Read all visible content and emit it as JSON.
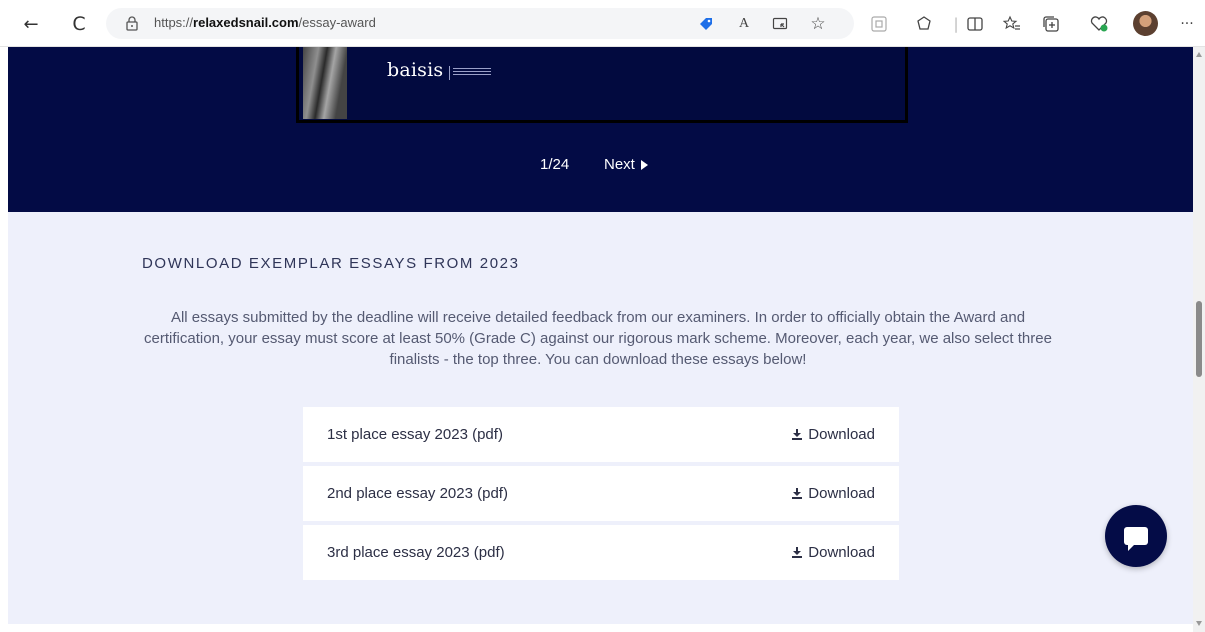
{
  "browser": {
    "url_prefix": "https://",
    "url_domain": "relaxedsnail.com",
    "url_path": "/essay-award",
    "nav": {
      "back": "←",
      "reload": "C"
    },
    "address_icons": [
      "price-tag-icon",
      "read-aloud-icon",
      "app-icon",
      "favorite-star-icon"
    ],
    "toolbar_icons": [
      "extension-icon",
      "refresh-extension-icon",
      "split-screen-icon",
      "favorites-icon",
      "collections-icon",
      "health-icon",
      "profile-avatar",
      "more-icon"
    ],
    "more_label": "···",
    "read_aloud_label": "A",
    "favorite_label": "☆"
  },
  "banner": {
    "brand": "baisis",
    "pager_count": "1/24",
    "next_label": "Next"
  },
  "section": {
    "heading": "DOWNLOAD EXEMPLAR ESSAYS FROM 2023",
    "paragraph": "All essays submitted by the deadline will receive detailed feedback from our examiners. In order to officially obtain the Award and certification, your essay must score at least 50% (Grade C) against our rigorous mark scheme. Moreover, each year, we also select three finalists - the top three. You can download these essays below!",
    "downloads": [
      {
        "label": "1st place essay 2023 (pdf)",
        "action": "Download"
      },
      {
        "label": "2nd place essay 2023 (pdf)",
        "action": "Download"
      },
      {
        "label": "3rd place essay 2023 (pdf)",
        "action": "Download"
      }
    ]
  },
  "colors": {
    "banner_bg": "#030b45",
    "section_bg": "#eef0fb",
    "chat_bg": "#040c47"
  }
}
